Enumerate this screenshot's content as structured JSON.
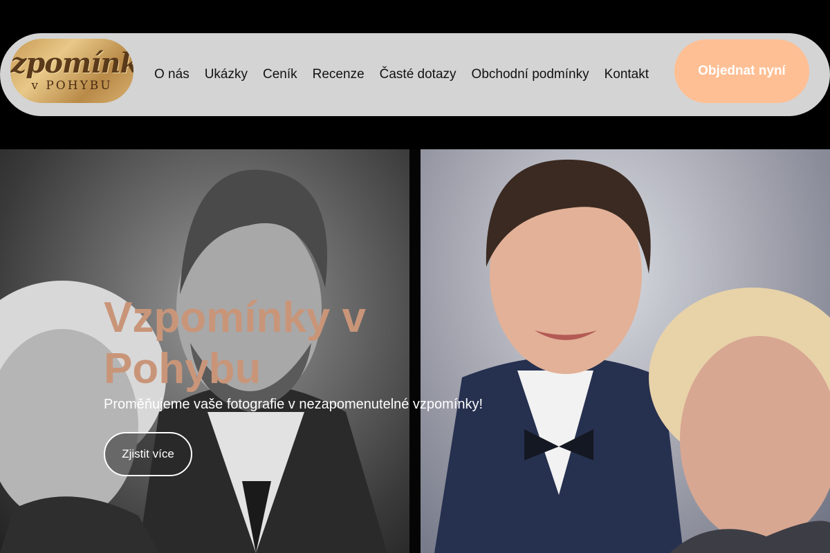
{
  "header": {
    "logo": {
      "line1": "Vzpomínky",
      "line2": "v POHYBU"
    },
    "nav": [
      {
        "label": "O nás"
      },
      {
        "label": "Ukázky"
      },
      {
        "label": "Ceník"
      },
      {
        "label": "Recenze"
      },
      {
        "label": "Časté dotazy"
      },
      {
        "label": "Obchodní podmínky"
      },
      {
        "label": "Kontakt"
      }
    ],
    "cta_label": "Objednat nyní"
  },
  "hero": {
    "title": "Vzpomínky v Pohybu",
    "subtitle": "Proměňujeme vaše fotografie v nezapomenutelné vzpomínky!",
    "button_label": "Zjistit více",
    "images": [
      {
        "name": "black-and-white-portrait",
        "icon": "photo-bw"
      },
      {
        "name": "colorized-portrait",
        "icon": "photo-color"
      }
    ]
  },
  "colors": {
    "page_background": "#000000",
    "navbar_background": "#d4d4d4",
    "cta_background": "#ffbf94",
    "hero_title": "#c99579"
  }
}
